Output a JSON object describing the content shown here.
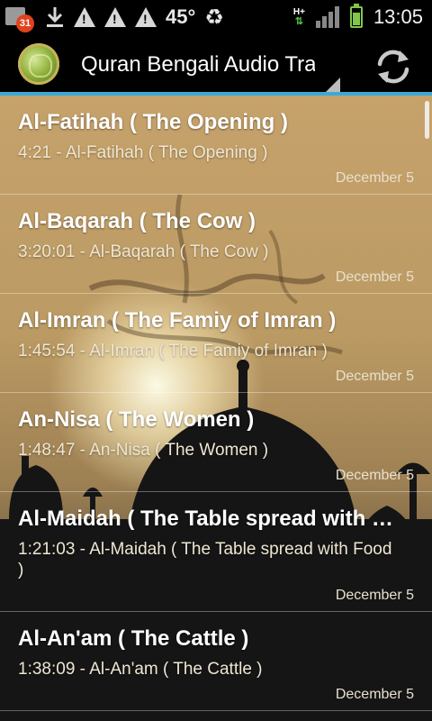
{
  "status_bar": {
    "calendar_badge": "31",
    "temperature": "45°",
    "network_label": "H+",
    "time": "13:05"
  },
  "action_bar": {
    "title": "Quran Bengali Audio Tra"
  },
  "tracks": [
    {
      "title": "Al-Fatihah ( The Opening )",
      "subtitle": "4:21 - Al-Fatihah ( The Opening )",
      "date": "December 5"
    },
    {
      "title": "Al-Baqarah ( The Cow )",
      "subtitle": "3:20:01 - Al-Baqarah ( The Cow )",
      "date": "December 5"
    },
    {
      "title": "Al-Imran ( The Famiy of Imran )",
      "subtitle": "1:45:54 - Al-Imran ( The Famiy of Imran )",
      "date": "December 5"
    },
    {
      "title": "An-Nisa ( The Women )",
      "subtitle": "1:48:47 - An-Nisa ( The Women )",
      "date": "December 5"
    },
    {
      "title": "Al-Maidah ( The Table spread with …",
      "subtitle": "1:21:03 - Al-Maidah ( The Table spread with Food )",
      "date": "December 5"
    },
    {
      "title": "Al-An'am ( The Cattle )",
      "subtitle": "1:38:09 - Al-An'am ( The Cattle )",
      "date": "December 5"
    }
  ],
  "icons": {
    "app": "quran-app-icon",
    "refresh": "refresh-icon",
    "dropdown": "dropdown-indicator-icon"
  },
  "colors": {
    "accent": "#3aa9d9",
    "background_top": "#c6a26b",
    "background_bottom": "#1c1c1c"
  }
}
